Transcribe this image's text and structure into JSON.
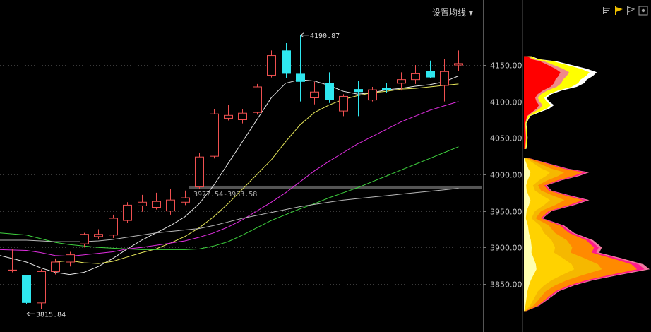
{
  "toolbar": {
    "set_ma_label": "设置均线",
    "dropdown_glyph": "▾",
    "icons": [
      "cost-distribution-icon",
      "active-flag-icon",
      "history-icon",
      "settings-icon"
    ]
  },
  "colors": {
    "background": "#000000",
    "grid": "#3a3a3a",
    "up_candle": "#f05050",
    "down_candle": "#2fe7ef",
    "ma_white": "#e8e8e8",
    "ma_yellow": "#e6e65a",
    "ma_magenta": "#e02ee0",
    "ma_green": "#3ed13e",
    "ma_long": "#b8b8b8",
    "axis_text": "#c8c8c8"
  },
  "annotations": {
    "high_label": "4190.87",
    "low_label": "3815.84",
    "band_label": "3977.54-3983.58"
  },
  "chart_data": {
    "type": "candlestick",
    "ylim": [
      3815,
      4195
    ],
    "y_ticks": [
      "4150.00",
      "4100.00",
      "4050.00",
      "4000.00",
      "3950.00",
      "3900.00",
      "3850.00"
    ],
    "y_tick_values": [
      4150,
      4100,
      4050,
      4000,
      3950,
      3900,
      3850
    ],
    "grid": true,
    "candles": [
      {
        "o": 3869,
        "h": 3898,
        "l": 3866,
        "c": 3869
      },
      {
        "o": 3862,
        "h": 3862,
        "l": 3822,
        "c": 3824
      },
      {
        "o": 3824,
        "h": 3870,
        "l": 3816,
        "c": 3867
      },
      {
        "o": 3867,
        "h": 3885,
        "l": 3863,
        "c": 3880
      },
      {
        "o": 3880,
        "h": 3894,
        "l": 3874,
        "c": 3890
      },
      {
        "o": 3905,
        "h": 3920,
        "l": 3900,
        "c": 3918
      },
      {
        "o": 3915,
        "h": 3925,
        "l": 3912,
        "c": 3918
      },
      {
        "o": 3917,
        "h": 3945,
        "l": 3913,
        "c": 3940
      },
      {
        "o": 3937,
        "h": 3962,
        "l": 3934,
        "c": 3958
      },
      {
        "o": 3957,
        "h": 3972,
        "l": 3949,
        "c": 3962
      },
      {
        "o": 3955,
        "h": 3975,
        "l": 3952,
        "c": 3963
      },
      {
        "o": 3950,
        "h": 3980,
        "l": 3945,
        "c": 3965
      },
      {
        "o": 3962,
        "h": 3978,
        "l": 3958,
        "c": 3968
      },
      {
        "o": 3983,
        "h": 4030,
        "l": 3980,
        "c": 4024
      },
      {
        "o": 4025,
        "h": 4090,
        "l": 4022,
        "c": 4083
      },
      {
        "o": 4077,
        "h": 4095,
        "l": 4074,
        "c": 4081
      },
      {
        "o": 4075,
        "h": 4090,
        "l": 4070,
        "c": 4084
      },
      {
        "o": 4085,
        "h": 4124,
        "l": 4082,
        "c": 4120
      },
      {
        "o": 4136,
        "h": 4170,
        "l": 4133,
        "c": 4163
      },
      {
        "o": 4170,
        "h": 4180,
        "l": 4132,
        "c": 4138
      },
      {
        "o": 4138,
        "h": 4191,
        "l": 4100,
        "c": 4127
      },
      {
        "o": 4105,
        "h": 4127,
        "l": 4096,
        "c": 4113
      },
      {
        "o": 4125,
        "h": 4140,
        "l": 4098,
        "c": 4102
      },
      {
        "o": 4087,
        "h": 4110,
        "l": 4080,
        "c": 4107
      },
      {
        "o": 4117,
        "h": 4128,
        "l": 4080,
        "c": 4113
      },
      {
        "o": 4102,
        "h": 4120,
        "l": 4100,
        "c": 4116
      },
      {
        "o": 4119,
        "h": 4125,
        "l": 4112,
        "c": 4116
      },
      {
        "o": 4125,
        "h": 4140,
        "l": 4115,
        "c": 4130
      },
      {
        "o": 4130,
        "h": 4150,
        "l": 4124,
        "c": 4138
      },
      {
        "o": 4142,
        "h": 4156,
        "l": 4132,
        "c": 4133
      },
      {
        "o": 4122,
        "h": 4158,
        "l": 4100,
        "c": 4141
      },
      {
        "o": 4150,
        "h": 4170,
        "l": 4142,
        "c": 4152
      }
    ],
    "moving_averages": [
      {
        "color_key": "ma_white",
        "values": [
          3889,
          3880,
          3872,
          3866,
          3863,
          3866,
          3874,
          3885,
          3898,
          3910,
          3920,
          3930,
          3942,
          3960,
          3985,
          4015,
          4045,
          4075,
          4105,
          4125,
          4130,
          4128,
          4122,
          4114,
          4110,
          4112,
          4116,
          4118,
          4121,
          4123,
          4127,
          4135
        ]
      },
      {
        "color_key": "ma_yellow",
        "values": [
          null,
          null,
          null,
          3880,
          3882,
          3879,
          3878,
          3881,
          3887,
          3893,
          3898,
          3906,
          3915,
          3927,
          3942,
          3960,
          3980,
          4000,
          4020,
          4045,
          4068,
          4085,
          4095,
          4103,
          4108,
          4112,
          4114,
          4117,
          4118,
          4120,
          4122,
          4124
        ]
      },
      {
        "color_key": "ma_magenta",
        "values": [
          3897,
          3896,
          3893,
          3889,
          3888,
          3890,
          3892,
          3894,
          3898,
          3900,
          3903,
          3906,
          3909,
          3914,
          3920,
          3928,
          3938,
          3950,
          3962,
          3975,
          3990,
          4005,
          4018,
          4030,
          4042,
          4052,
          4062,
          4072,
          4080,
          4088,
          4094,
          4100
        ]
      },
      {
        "color_key": "ma_green",
        "values": [
          3920,
          3917,
          3912,
          3907,
          3904,
          3902,
          3900,
          3899,
          3898,
          3897,
          3897,
          3897,
          3897,
          3898,
          3902,
          3908,
          3917,
          3927,
          3937,
          3945,
          3953,
          3960,
          3968,
          3975,
          3982,
          3990,
          3998,
          4006,
          4014,
          4022,
          4030,
          4038
        ]
      },
      {
        "color_key": "ma_long",
        "values": [
          3910,
          3910,
          3909,
          3908,
          3908,
          3908,
          3909,
          3911,
          3914,
          3917,
          3920,
          3922,
          3924,
          3926,
          3930,
          3935,
          3940,
          3944,
          3948,
          3952,
          3956,
          3959,
          3962,
          3965,
          3967,
          3969,
          3971,
          3973,
          3975,
          3977,
          3979,
          3981
        ]
      }
    ],
    "volume_profile": {
      "upper": [
        {
          "price": 4162,
          "width": 0.06
        },
        {
          "price": 4158,
          "width": 0.12
        },
        {
          "price": 4155,
          "width": 0.26
        },
        {
          "price": 4150,
          "width": 0.38
        },
        {
          "price": 4145,
          "width": 0.5
        },
        {
          "price": 4140,
          "width": 0.58
        },
        {
          "price": 4135,
          "width": 0.55
        },
        {
          "price": 4130,
          "width": 0.5
        },
        {
          "price": 4125,
          "width": 0.48
        },
        {
          "price": 4120,
          "width": 0.42
        },
        {
          "price": 4115,
          "width": 0.3
        },
        {
          "price": 4110,
          "width": 0.22
        },
        {
          "price": 4105,
          "width": 0.18
        },
        {
          "price": 4100,
          "width": 0.2
        },
        {
          "price": 4095,
          "width": 0.24
        },
        {
          "price": 4090,
          "width": 0.2
        },
        {
          "price": 4085,
          "width": 0.12
        },
        {
          "price": 4080,
          "width": 0.05
        },
        {
          "price": 4070,
          "width": 0.02
        },
        {
          "price": 4050,
          "width": 0.03
        },
        {
          "price": 4035,
          "width": 0.02
        }
      ],
      "lower": [
        {
          "price": 4022,
          "width": 0.05
        },
        {
          "price": 4015,
          "width": 0.2
        },
        {
          "price": 4008,
          "width": 0.35
        },
        {
          "price": 4003,
          "width": 0.52
        },
        {
          "price": 3998,
          "width": 0.44
        },
        {
          "price": 3992,
          "width": 0.3
        },
        {
          "price": 3985,
          "width": 0.18
        },
        {
          "price": 3978,
          "width": 0.22
        },
        {
          "price": 3972,
          "width": 0.35
        },
        {
          "price": 3965,
          "width": 0.52
        },
        {
          "price": 3958,
          "width": 0.4
        },
        {
          "price": 3950,
          "width": 0.22
        },
        {
          "price": 3940,
          "width": 0.15
        },
        {
          "price": 3930,
          "width": 0.32
        },
        {
          "price": 3920,
          "width": 0.4
        },
        {
          "price": 3910,
          "width": 0.55
        },
        {
          "price": 3900,
          "width": 0.62
        },
        {
          "price": 3893,
          "width": 0.6
        },
        {
          "price": 3885,
          "width": 0.78
        },
        {
          "price": 3877,
          "width": 0.95
        },
        {
          "price": 3870,
          "width": 1.0
        },
        {
          "price": 3862,
          "width": 0.75
        },
        {
          "price": 3855,
          "width": 0.55
        },
        {
          "price": 3848,
          "width": 0.4
        },
        {
          "price": 3840,
          "width": 0.28
        },
        {
          "price": 3830,
          "width": 0.2
        },
        {
          "price": 3820,
          "width": 0.12
        },
        {
          "price": 3813,
          "width": 0.02
        }
      ]
    }
  }
}
